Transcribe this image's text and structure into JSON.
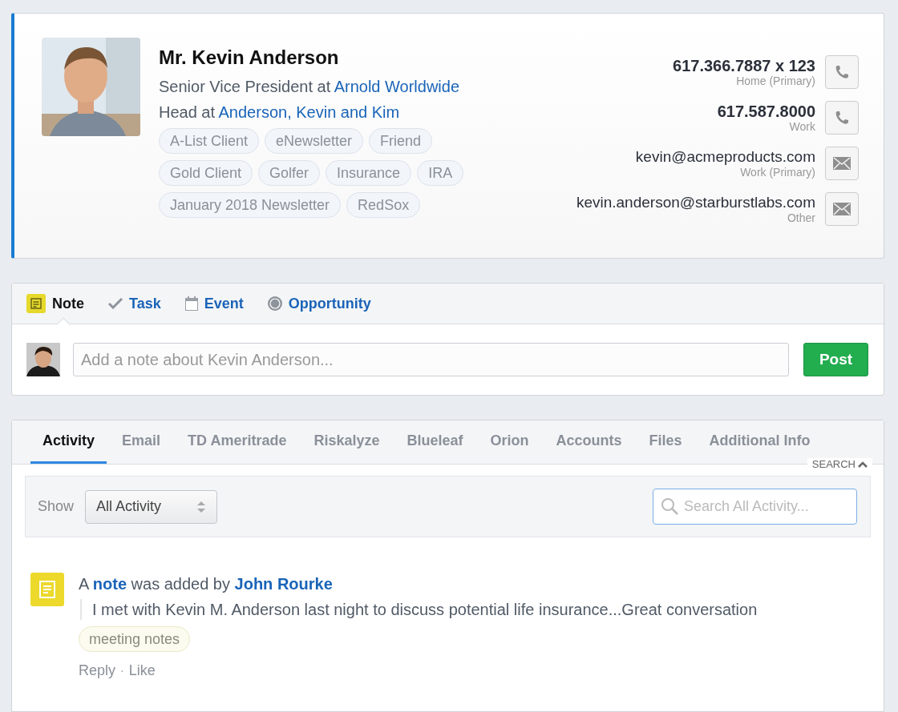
{
  "contact": {
    "name": "Mr. Kevin Anderson",
    "positions": [
      {
        "text": "Senior Vice President at",
        "link": "Arnold Worldwide"
      },
      {
        "text": "Head at",
        "link": "Anderson, Kevin and Kim"
      }
    ],
    "tags": [
      "A-List Client",
      "eNewsletter",
      "Friend",
      "Gold Client",
      "Golfer",
      "Insurance",
      "IRA",
      "January 2018 Newsletter",
      "RedSox"
    ],
    "methods": [
      {
        "kind": "phone",
        "value": "617.366.7887 x 123",
        "label": "Home (Primary)"
      },
      {
        "kind": "phone",
        "value": "617.587.8000",
        "label": "Work"
      },
      {
        "kind": "email",
        "value": "kevin@acmeproducts.com",
        "label": "Work (Primary)"
      },
      {
        "kind": "email",
        "value": "kevin.anderson@starburstlabs.com",
        "label": "Other"
      }
    ]
  },
  "composer": {
    "tabs": [
      {
        "label": "Note",
        "kind": "note",
        "selected": true
      },
      {
        "label": "Task",
        "kind": "task",
        "selected": false
      },
      {
        "label": "Event",
        "kind": "event",
        "selected": false
      },
      {
        "label": "Opportunity",
        "kind": "opportunity",
        "selected": false
      }
    ],
    "placeholder": "Add a note about Kevin Anderson...",
    "button": "Post"
  },
  "activity": {
    "tabs": [
      {
        "label": "Activity",
        "selected": true
      },
      {
        "label": "Email",
        "selected": false
      },
      {
        "label": "TD Ameritrade",
        "selected": false
      },
      {
        "label": "Riskalyze",
        "selected": false
      },
      {
        "label": "Blueleaf",
        "selected": false
      },
      {
        "label": "Orion",
        "selected": false
      },
      {
        "label": "Accounts",
        "selected": false
      },
      {
        "label": "Files",
        "selected": false
      },
      {
        "label": "Additional Info",
        "selected": false
      }
    ],
    "search_toggle": "SEARCH",
    "show_label": "Show",
    "filter": "All Activity",
    "search_placeholder": "Search All Activity...",
    "items": [
      {
        "text": "A **note** was added by **John Rourke**",
        "body": "I met with Kevin M. Anderson last night to discuss potential life insurance...Great conversation",
        "tag": "meeting notes",
        "actions": [
          "Reply",
          "Like"
        ],
        "separator": "·"
      }
    ]
  }
}
